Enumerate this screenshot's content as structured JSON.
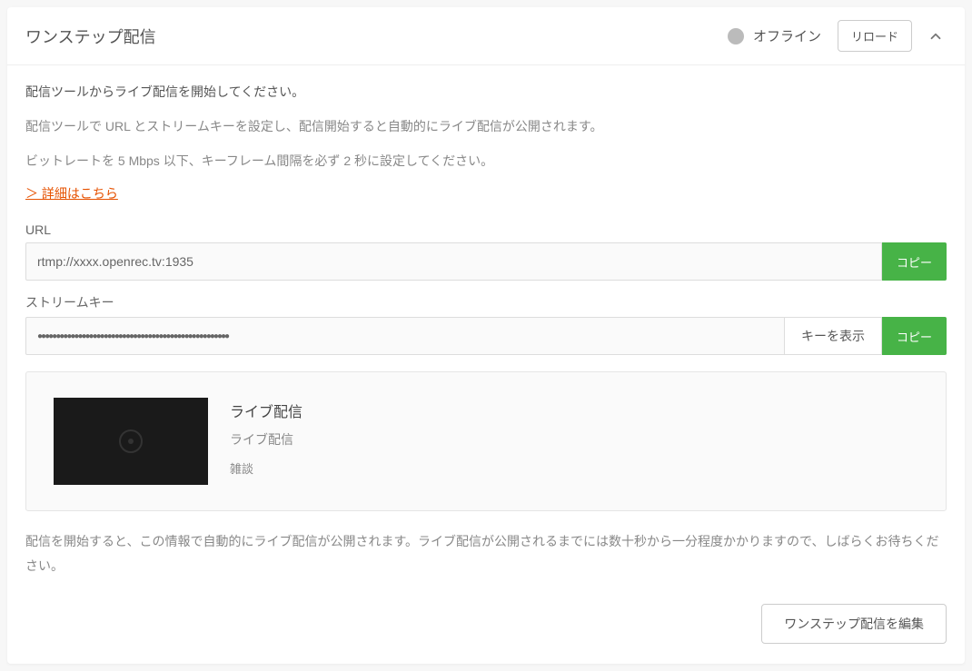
{
  "header": {
    "title": "ワンステップ配信",
    "status_label": "オフライン",
    "reload_label": "リロード"
  },
  "instructions": {
    "line1": "配信ツールからライブ配信を開始してください。",
    "line2": "配信ツールで URL とストリームキーを設定し、配信開始すると自動的にライブ配信が公開されます。",
    "line3": "ビットレートを 5 Mbps 以下、キーフレーム間隔を必ず 2 秒に設定してください。",
    "details_link": "＞ 詳細はこちら"
  },
  "url_field": {
    "label": "URL",
    "value": "rtmp://xxxx.openrec.tv:1935",
    "copy_label": "コピー"
  },
  "stream_key_field": {
    "label": "ストリームキー",
    "value": "●●●●●●●●●●●●●●●●●●●●●●●●●●●●●●●●●●●●●●●●●●●●●●●●●●●●",
    "show_label": "キーを表示",
    "copy_label": "コピー"
  },
  "preview": {
    "title": "ライブ配信",
    "subtitle": "ライブ配信",
    "tag": "雑談"
  },
  "footer": {
    "note": "配信を開始すると、この情報で自動的にライブ配信が公開されます。ライブ配信が公開されるまでには数十秒から一分程度かかりますので、しばらくお待ちください。",
    "edit_label": "ワンステップ配信を編集"
  }
}
